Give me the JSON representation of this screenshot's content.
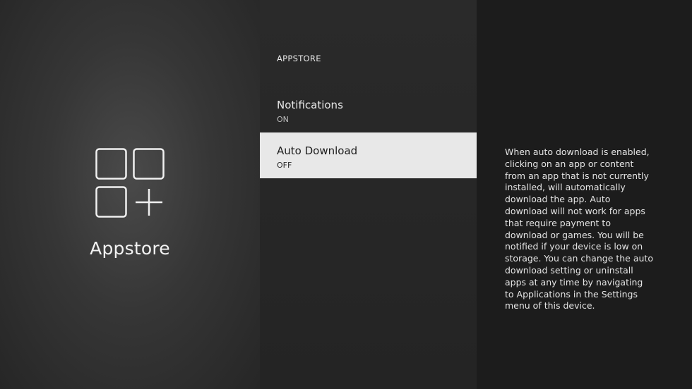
{
  "app": {
    "title": "Appstore",
    "icon": "appstore-grid-plus-icon"
  },
  "settings": {
    "section_header": "APPSTORE",
    "items": [
      {
        "label": "Notifications",
        "value": "ON",
        "selected": false
      },
      {
        "label": "Auto Download",
        "value": "OFF",
        "selected": true
      }
    ]
  },
  "description": {
    "text": "When auto download is enabled, clicking on an app or content from an app that is not currently installed, will automatically download the app. Auto download will not work for apps that require payment to download or games. You will be notified if your device is low on storage. You can change the auto download setting or uninstall apps at any time by navigating to Applications in the Settings menu of this device."
  },
  "colors": {
    "selected_background": "#e8e8e8",
    "text_light": "#e6e6e6",
    "text_dark": "#1d1d1d"
  }
}
